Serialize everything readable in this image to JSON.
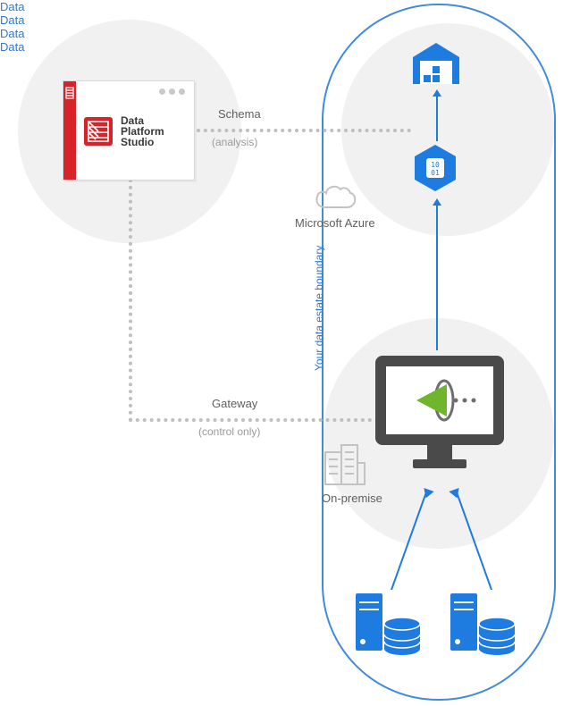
{
  "studio": {
    "brand_line1": "Data",
    "brand_line2": "Platform",
    "brand_line3": "Studio"
  },
  "connectors": {
    "schema_label": "Schema",
    "schema_sub": "(analysis)",
    "gateway_label": "Gateway",
    "gateway_sub": "(control only)"
  },
  "boundary": {
    "vertical_label": "Your data estate boundary"
  },
  "azure": {
    "cloud_label": "Microsoft Azure",
    "data_label_upper": "Data",
    "data_label_mid": "Data"
  },
  "onprem": {
    "label": "On-premise",
    "data_left": "Data",
    "data_right": "Data"
  }
}
